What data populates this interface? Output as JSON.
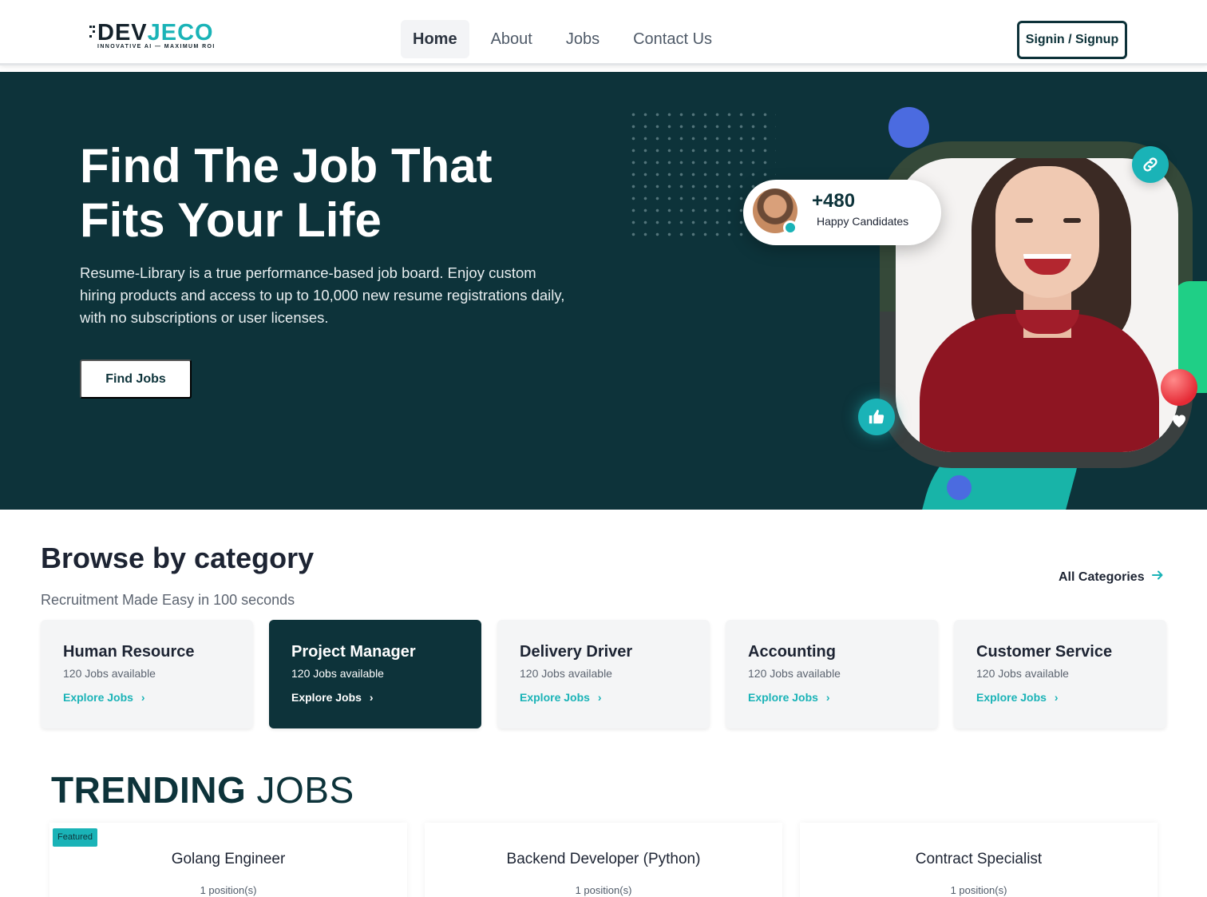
{
  "brand": {
    "name_part1": "DEV",
    "name_part2": "JECO",
    "tagline": "INNOVATIVE AI — MAXIMUM ROI",
    "dark_color": "#14222b",
    "accent_color": "#1ab3b7"
  },
  "nav": {
    "links": [
      {
        "label": "Home",
        "active": true
      },
      {
        "label": "About",
        "active": false
      },
      {
        "label": "Jobs",
        "active": false
      },
      {
        "label": "Contact Us",
        "active": false
      }
    ],
    "signin_label": "Signin / Signup"
  },
  "hero": {
    "title_line1": "Find The Job That",
    "title_line2": "Fits Your Life",
    "description": "Resume-Library is a true performance-based job board. Enjoy custom hiring products and access to up to 10,000 new resume registrations daily, with no subscriptions or user licenses.",
    "cta_label": "Find Jobs",
    "background": "#0d333a",
    "stat": {
      "value": "+480",
      "label": "Happy Candidates"
    },
    "icons": [
      "link-icon",
      "thumbs-up-icon",
      "heart-icon"
    ]
  },
  "browse": {
    "title": "Browse by category",
    "subtitle": "Recruitment Made Easy in 100 seconds",
    "all_categories_label": "All Categories",
    "categories": [
      {
        "name": "Human Resource",
        "count": "120 Jobs available",
        "explore": "Explore Jobs",
        "active": false
      },
      {
        "name": "Project Manager",
        "count": "120 Jobs available",
        "explore": "Explore Jobs",
        "active": true
      },
      {
        "name": "Delivery Driver",
        "count": "120 Jobs available",
        "explore": "Explore Jobs",
        "active": false
      },
      {
        "name": "Accounting",
        "count": "120 Jobs available",
        "explore": "Explore Jobs",
        "active": false
      },
      {
        "name": "Customer Service",
        "count": "120 Jobs available",
        "explore": "Explore Jobs",
        "active": false
      }
    ]
  },
  "trending": {
    "title_bold": "TRENDING",
    "title_light": "JOBS",
    "jobs": [
      {
        "badge": "Featured",
        "title": "Golang Engineer",
        "positions": "1 position(s)"
      },
      {
        "badge": "",
        "title": "Backend Developer (Python)",
        "positions": "1 position(s)"
      },
      {
        "badge": "",
        "title": "Contract Specialist",
        "positions": "1 position(s)"
      }
    ]
  }
}
